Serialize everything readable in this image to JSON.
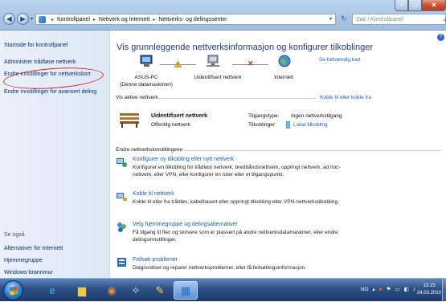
{
  "window": {
    "min": "–",
    "max": "□",
    "close": "✕"
  },
  "address": {
    "crumbs": [
      "Kontrollpanel",
      "Nettverk og Internett",
      "Nettverks- og delingssenter"
    ],
    "search_placeholder": "Søk i Kontrollpanel"
  },
  "sidebar": {
    "links": [
      "Startside for kontrollpanel",
      "Administrer trådløse nettverk",
      "Endre innstillinger for nettverkskort",
      "Endre innstillinger for avansert deling"
    ],
    "see_also_title": "Se også",
    "see_also": [
      "Alternativer for Internett",
      "Hjemmegruppe",
      "Windows-brannmur"
    ]
  },
  "main": {
    "title": "Vis grunnleggende nettverksinformasjon og konfigurer tilkoblinger",
    "full_map": "Se fullstendig kart",
    "map": {
      "pc": "ASUS-PC",
      "pc_sub": "(Denne datamaskinen)",
      "network": "Uidentifisert nettverk",
      "internet": "Internett"
    },
    "active_header": "Vis aktive nettverk",
    "connect_link": "Koble til eller koble fra",
    "net_name": "Uidentifisert nettverk",
    "net_type": "Offentlig nettverk",
    "access_label": "Tilgangstype:",
    "access_value": "Ingen nettverkstilgang",
    "conn_label": "Tilkoblinger:",
    "conn_value": "Lokal tilkobling",
    "settings_header": "Endre nettverksinnstillingene",
    "tasks": [
      {
        "title": "Konfigurer ny tilkobling eller nytt nettverk",
        "desc": "Konfigurer en tilkobling for trådløst nettverk, bredbåndsnettverk, oppringt nettverk, ad hoc-nettverk, eller VPN, eller konfigurer en ruter eller et tilgangspunkt."
      },
      {
        "title": "Koble til nettverk",
        "desc": "Koble til eller fra trådløs, kabelbasert eller oppringt tilkobling eller VPN-nettverkstilkobling."
      },
      {
        "title": "Velg hjemmegruppe og delingsalternativer",
        "desc": "Få tilgang til filer og skrivere som er plassert på andre nettverksdatamaskiner, eller endre delingsinnstillinger."
      },
      {
        "title": "Feilsøk problemer",
        "desc": "Diagnostiser og reparer nettverksproblemer, eller få feilsøkingsinformasjon."
      }
    ]
  },
  "taskbar": {
    "lang": "NO",
    "time": "13:15",
    "date": "24.03.2010"
  },
  "colors": {
    "link": "#1a5ac6",
    "title": "#1e3a8a",
    "sidebar_link": "#0b2f6e",
    "highlight": "#e0222a"
  }
}
